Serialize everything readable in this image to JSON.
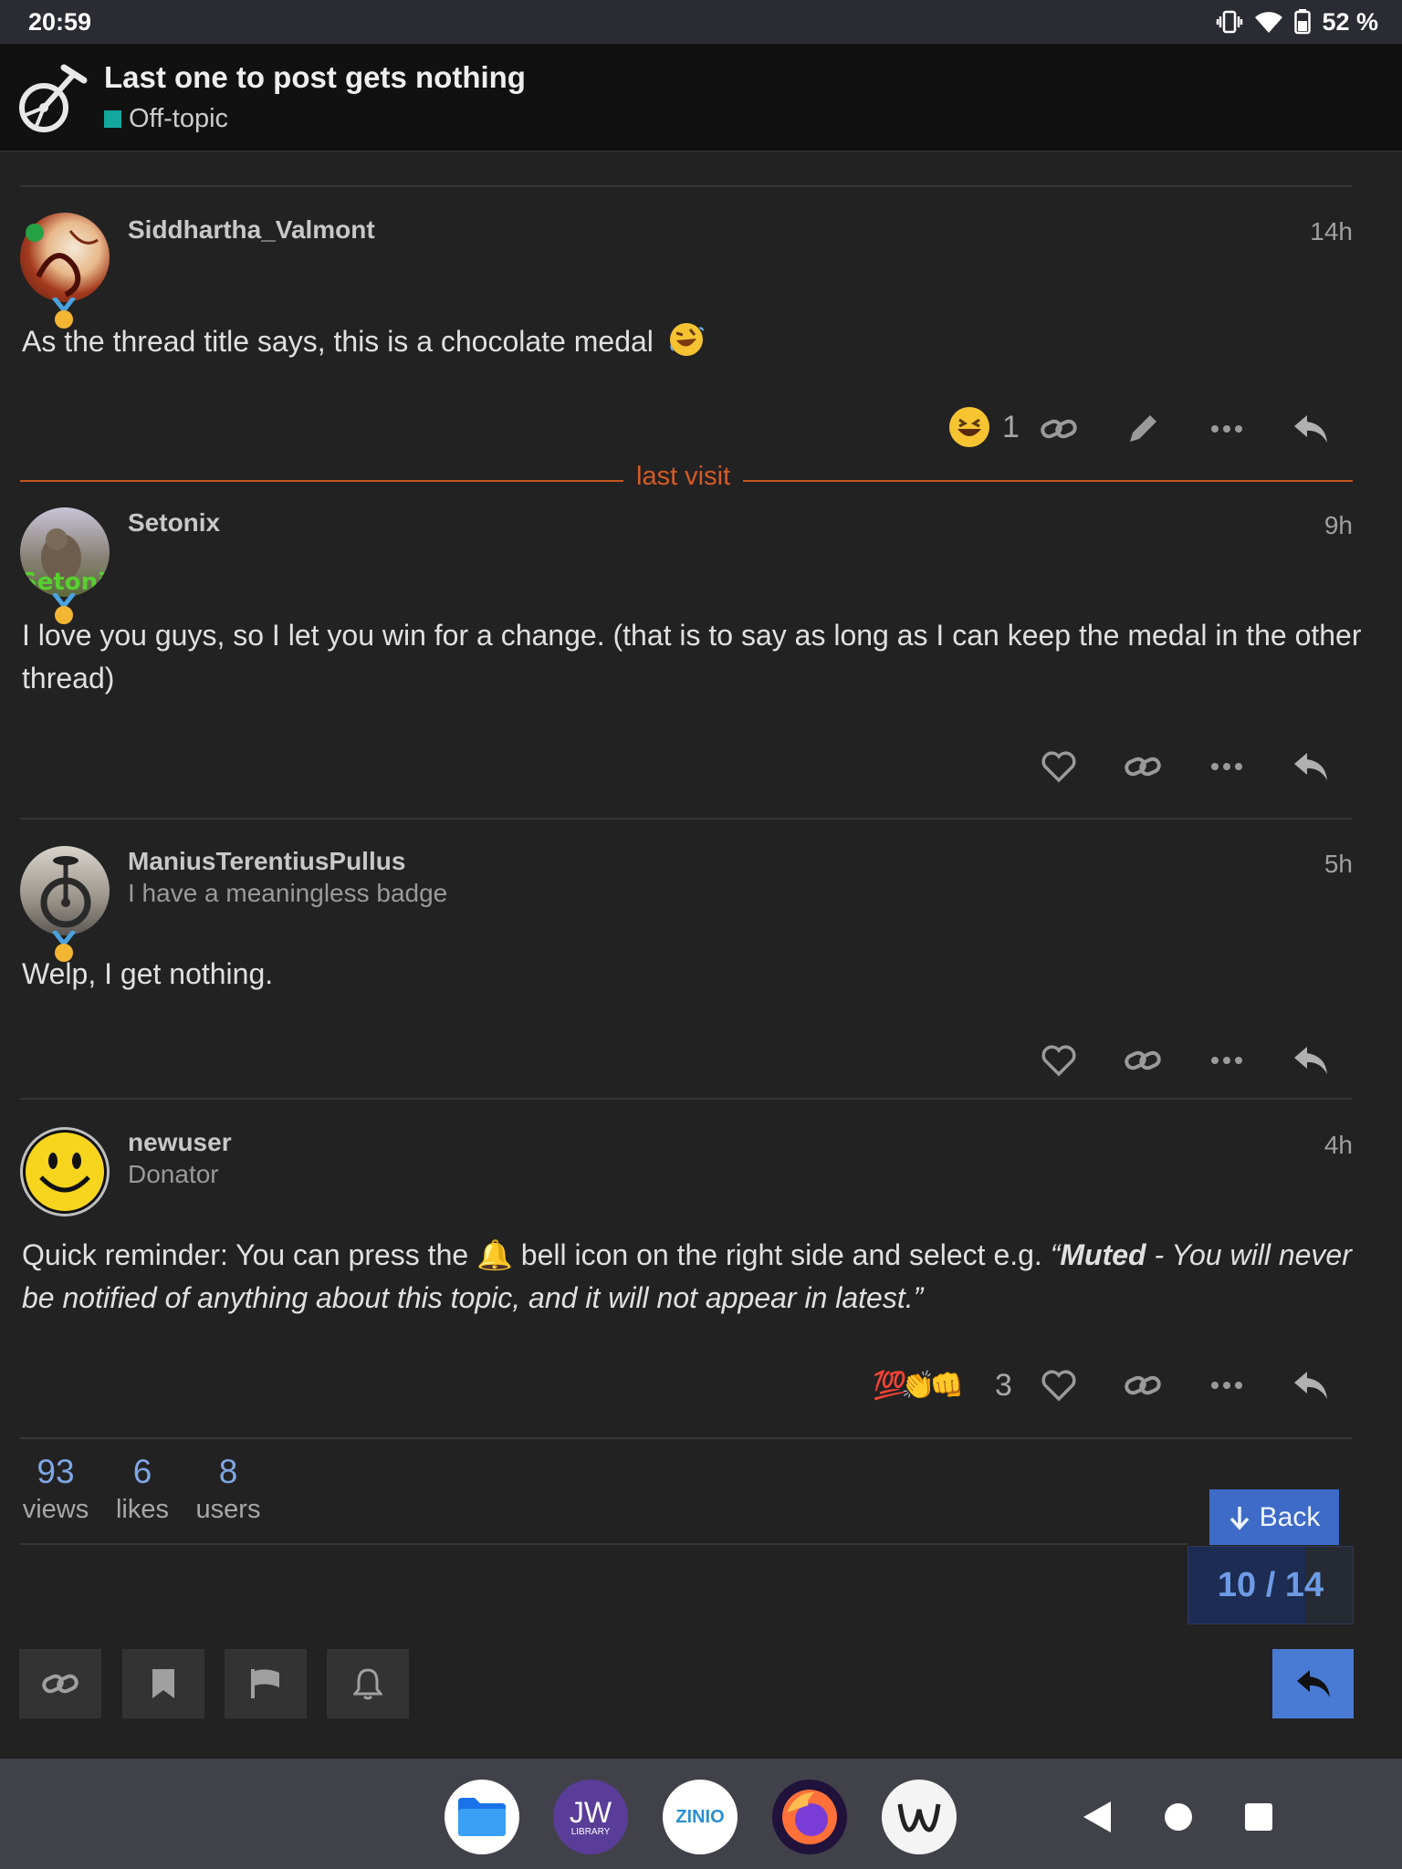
{
  "status_bar": {
    "time": "20:59",
    "battery": "52 %"
  },
  "header": {
    "title": "Last one to post gets nothing",
    "category": "Off-topic",
    "category_color": "#12a89d"
  },
  "posts": [
    {
      "username": "Siddhartha_Valmont",
      "user_title": "",
      "age": "14h",
      "body": "As the thread title says, this is a chocolate medal",
      "reactions": "😆",
      "reaction_count": "1"
    },
    {
      "username": "Setonix",
      "user_title": "",
      "age": "9h",
      "body": "I love you guys, so I let you win for a change. (that is to say as long as I can keep the medal in the other thread)",
      "avatar_text": "Setonix"
    },
    {
      "username": "ManiusTerentiusPullus",
      "user_title": "I have a meaningless badge",
      "age": "5h",
      "body": "Welp, I get nothing."
    },
    {
      "username": "newuser",
      "user_title": "Donator",
      "age": "4h",
      "body_part1": "Quick reminder: You can press the ",
      "body_bell": "🔔",
      "body_part2": " bell icon on the right side and select e.g. ",
      "body_quote_open": "“",
      "body_quote_bold": "Muted",
      "body_quote_rest": " - You will never be notified of anything about this topic, and it will not appear in latest.”",
      "reactions": "💯👏👊",
      "reaction_count": "3"
    }
  ],
  "last_visit_label": "last visit",
  "stats": [
    {
      "value": "93",
      "label": "views"
    },
    {
      "value": "6",
      "label": "likes"
    },
    {
      "value": "8",
      "label": "users"
    }
  ],
  "back_button": "Back",
  "progress": {
    "text": "10 / 14",
    "fraction": 0.71
  },
  "dock": {
    "jw_label": "JW",
    "jw_sub": "LIBRARY",
    "zinio_label": "ZINIO"
  },
  "colors": {
    "accent": "#4a7bd4",
    "last_visit": "#d55a26",
    "link_blue": "#7fa6e5"
  }
}
